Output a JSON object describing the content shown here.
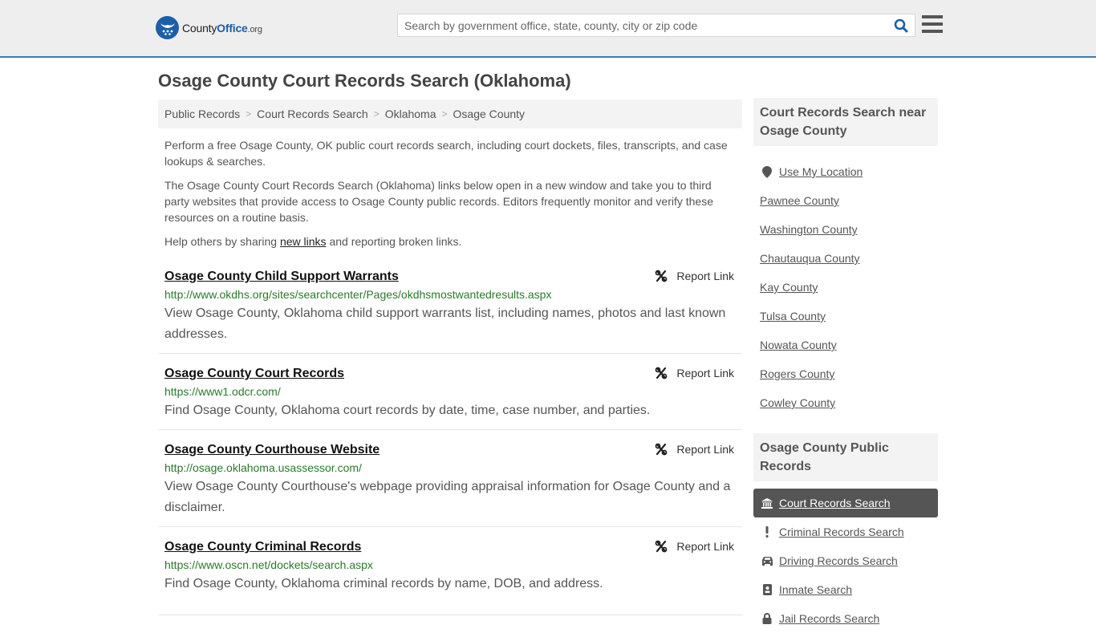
{
  "header": {
    "logo": {
      "name": "County",
      "name_bold": "Office",
      "tld": ".org"
    },
    "search": {
      "placeholder": "Search by government office, state, county, city or zip code",
      "value": ""
    }
  },
  "page": {
    "title": "Osage County Court Records Search (Oklahoma)"
  },
  "breadcrumb": [
    "Public Records",
    "Court Records Search",
    "Oklahoma",
    "Osage County"
  ],
  "intro": {
    "p1": "Perform a free Osage County, OK public court records search, including court dockets, files, transcripts, and case lookups & searches.",
    "p2": "The Osage County Court Records Search (Oklahoma) links below open in a new window and take you to third party websites that provide access to Osage County public records. Editors frequently monitor and verify these resources on a routine basis.",
    "p3_before": "Help others by sharing ",
    "p3_link": "new links",
    "p3_after": " and reporting broken links."
  },
  "results": [
    {
      "title": "Osage County Child Support Warrants",
      "url": "http://www.okdhs.org/sites/searchcenter/Pages/okdhsmostwantedresults.aspx",
      "description": "View Osage County, Oklahoma child support warrants list, including names, photos and last known addresses.",
      "report_label": "Report Link"
    },
    {
      "title": "Osage County Court Records",
      "url": "https://www1.odcr.com/",
      "description": "Find Osage County, Oklahoma court records by date, time, case number, and parties.",
      "report_label": "Report Link"
    },
    {
      "title": "Osage County Courthouse Website",
      "url": "http://osage.oklahoma.usassessor.com/",
      "description": "View Osage County Courthouse's webpage providing appraisal information for Osage County and a disclaimer.",
      "report_label": "Report Link"
    },
    {
      "title": "Osage County Criminal Records",
      "url": "https://www.oscn.net/dockets/search.aspx",
      "description": "Find Osage County, Oklahoma criminal records by name, DOB, and address.",
      "report_label": "Report Link"
    }
  ],
  "sidebar": {
    "near_heading": "Court Records Search near Osage County",
    "use_location": "Use My Location",
    "nearby": [
      "Pawnee County",
      "Washington County",
      "Chautauqua County",
      "Kay County",
      "Tulsa County",
      "Nowata County",
      "Rogers County",
      "Cowley County"
    ],
    "public_records_heading": "Osage County Public Records",
    "public_records": [
      {
        "label": "Court Records Search",
        "icon": "bank-icon",
        "active": true
      },
      {
        "label": "Criminal Records Search",
        "icon": "exclamation-icon",
        "active": false
      },
      {
        "label": "Driving Records Search",
        "icon": "car-icon",
        "active": false
      },
      {
        "label": "Inmate Search",
        "icon": "id-badge-icon",
        "active": false
      },
      {
        "label": "Jail Records Search",
        "icon": "lock-icon",
        "active": false
      }
    ]
  },
  "colors": {
    "accent": "#3a7ab8",
    "brand": "#1b5fa8",
    "url_green": "#2a7a2a",
    "active_bg": "#555555"
  }
}
